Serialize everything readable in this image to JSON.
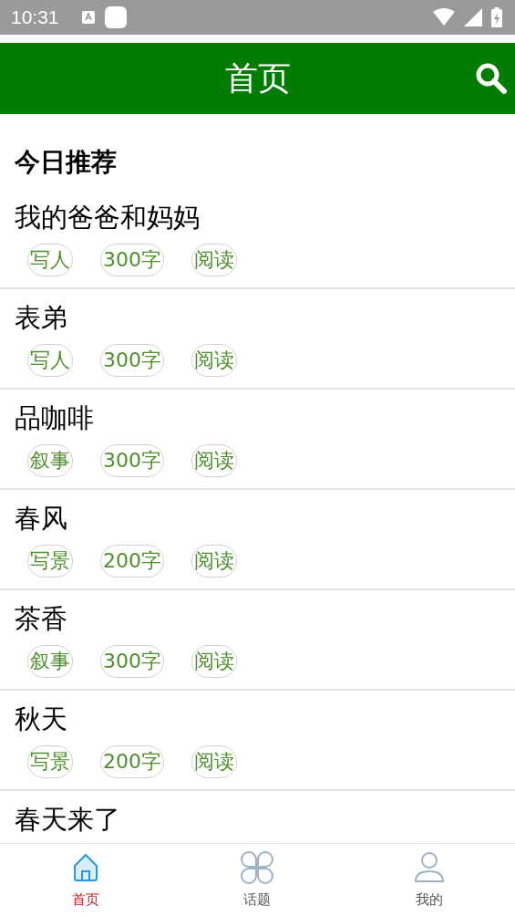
{
  "status_bar": {
    "time": "10:31"
  },
  "header": {
    "title": "首页"
  },
  "section": {
    "title": "今日推荐"
  },
  "articles": [
    {
      "title": "我的爸爸和妈妈",
      "tags": [
        "写人",
        "300字",
        "阅读"
      ]
    },
    {
      "title": "表弟",
      "tags": [
        "写人",
        "300字",
        "阅读"
      ]
    },
    {
      "title": "品咖啡",
      "tags": [
        "叙事",
        "300字",
        "阅读"
      ]
    },
    {
      "title": "春风",
      "tags": [
        "写景",
        "200字",
        "阅读"
      ]
    },
    {
      "title": "茶香",
      "tags": [
        "叙事",
        "300字",
        "阅读"
      ]
    },
    {
      "title": "秋天",
      "tags": [
        "写景",
        "200字",
        "阅读"
      ]
    },
    {
      "title": "春天来了"
    }
  ],
  "tab_bar": [
    {
      "kind": "home",
      "label": "首页",
      "selected": true
    },
    {
      "kind": "topics",
      "label": "话题",
      "selected": false
    },
    {
      "kind": "profile",
      "label": "我的",
      "selected": false
    }
  ]
}
